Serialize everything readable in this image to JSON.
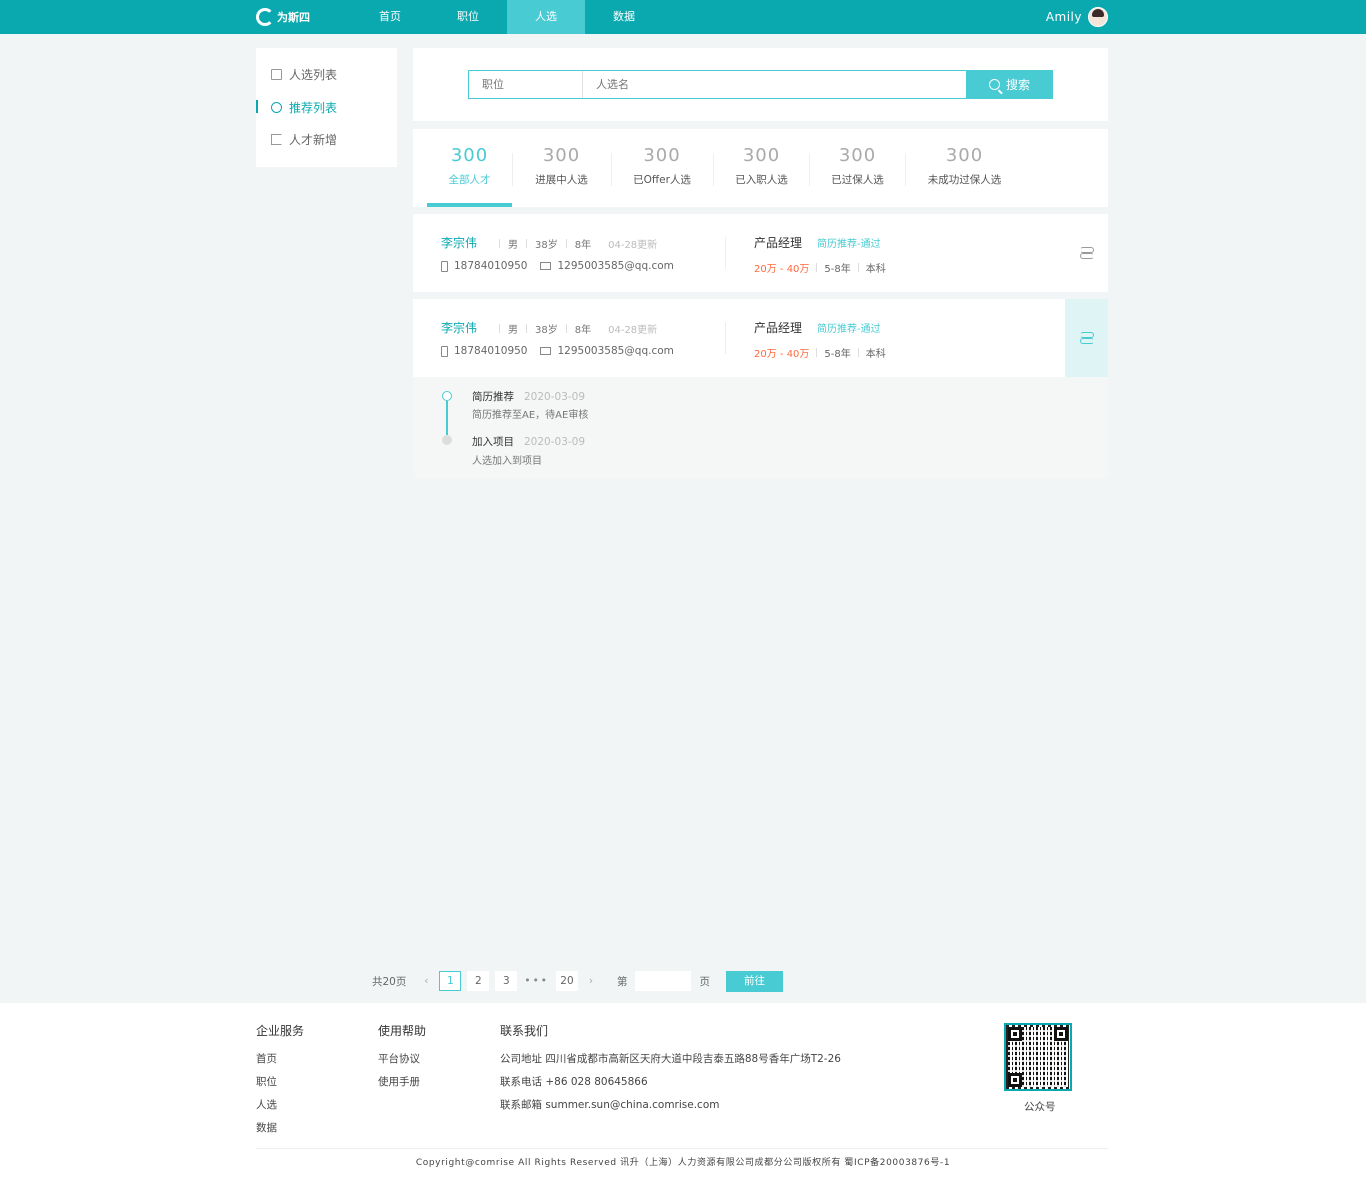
{
  "header": {
    "logo_text": "为斯四",
    "nav": [
      "首页",
      "职位",
      "人选",
      "数据"
    ],
    "active_nav": 2,
    "user_name": "Amily"
  },
  "sidebar": {
    "items": [
      {
        "label": "人选列表",
        "icon": "list-icon"
      },
      {
        "label": "推荐列表",
        "icon": "user-circle-icon"
      },
      {
        "label": "人才新增",
        "icon": "add-talent-icon"
      }
    ],
    "active": 1
  },
  "search": {
    "position_placeholder": "职位",
    "name_placeholder": "人选名",
    "button_label": "搜索"
  },
  "tabs": [
    {
      "count": "300",
      "label": "全部人才"
    },
    {
      "count": "300",
      "label": "进展中人选"
    },
    {
      "count": "300",
      "label": "已Offer人选"
    },
    {
      "count": "300",
      "label": "已入职人选"
    },
    {
      "count": "300",
      "label": "已过保人选"
    },
    {
      "count": "300",
      "label": "未成功过保人选"
    }
  ],
  "candidates": [
    {
      "name": "李宗伟",
      "gender": "男",
      "age": "38岁",
      "experience": "8年",
      "updated": "04-28更新",
      "phone": "18784010950",
      "email": "1295003585@qq.com",
      "job": "产品经理",
      "status": "简历推荐-通过",
      "salary": "20万 - 40万",
      "years": "5-8年",
      "degree": "本科"
    },
    {
      "name": "李宗伟",
      "gender": "男",
      "age": "38岁",
      "experience": "8年",
      "updated": "04-28更新",
      "phone": "18784010950",
      "email": "1295003585@qq.com",
      "job": "产品经理",
      "status": "简历推荐-通过",
      "salary": "20万 - 40万",
      "years": "5-8年",
      "degree": "本科"
    }
  ],
  "timeline": [
    {
      "title": "简历推荐",
      "date": "2020-03-09",
      "desc": "简历推荐至AE，待AE审核"
    },
    {
      "title": "加入项目",
      "date": "2020-03-09",
      "desc": "人选加入到项目"
    }
  ],
  "pagination": {
    "total": "共20页",
    "pages": [
      "1",
      "2",
      "3",
      "20"
    ],
    "current": "1",
    "goto_prefix": "第",
    "goto_suffix": "页",
    "goto_button": "前往"
  },
  "footer": {
    "col1": {
      "title": "企业服务",
      "links": [
        "首页",
        "职位",
        "人选",
        "数据"
      ]
    },
    "col2": {
      "title": "使用帮助",
      "links": [
        "平台协议",
        "使用手册"
      ]
    },
    "col3": {
      "title": "联系我们",
      "address": "公司地址  四川省成都市高新区天府大道中段吉泰五路88号香年广场T2-26",
      "phone": "联系电话  +86 028 80645866",
      "email": "联系邮箱  summer.sun@china.comrise.com"
    },
    "qr_caption": "公众号",
    "copyright": "Copyright@comrise All Rights Reserved 讯升（上海）人力资源有限公司成都分公司版权所有  蜀ICP备20003876号-1"
  },
  "colors": {
    "primary": "#0aa9b0",
    "accent": "#49cbd3",
    "salary": "#ff6a3d"
  }
}
